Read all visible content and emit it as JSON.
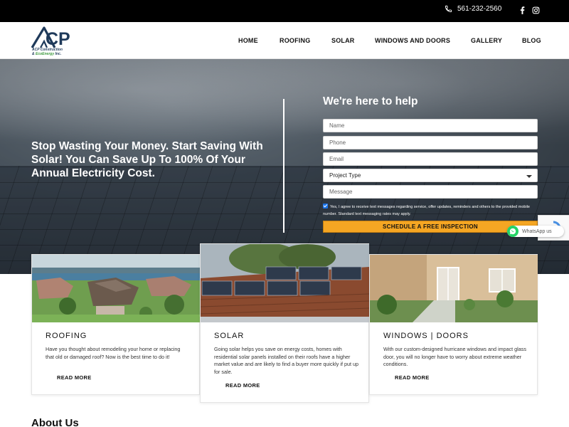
{
  "topbar": {
    "phone": "561-232-2560",
    "social": [
      "facebook-icon",
      "instagram-icon"
    ]
  },
  "brand": {
    "logo_letters": "CP",
    "logo_line1": "ACP Construction",
    "logo_line2_prefix": "& ",
    "logo_line2_eco": "EcoEnergy",
    "logo_line2_suffix": " Inc."
  },
  "nav": {
    "items": [
      "HOME",
      "ROOFING",
      "SOLAR",
      "WINDOWS AND DOORS",
      "GALLERY",
      "BLOG"
    ]
  },
  "hero": {
    "headline": "Stop Wasting Your Money. Start Saving With Solar! You Can Save Up To 100% Of Your Annual Electricity Cost."
  },
  "form": {
    "title": "We're here to help",
    "name_placeholder": "Name",
    "phone_placeholder": "Phone",
    "email_placeholder": "Email",
    "project_type": "Project Type",
    "message_placeholder": "Message",
    "consent_text": "Yes, I agree to receive text messages regarding service, offer updates, reminders and others to the provided mobile number. Standard text messaging rates may apply.",
    "consent_checked": true,
    "submit_label": "SCHEDULE A FREE INSPECTION"
  },
  "widgets": {
    "whatsapp_label": "WhatsApp us"
  },
  "services": [
    {
      "title": "ROOFING",
      "description": "Have you thought about remodeling your home or replacing that old or damaged roof? Now is the best time to do it!",
      "link": "READ MORE"
    },
    {
      "title": "SOLAR",
      "description": "Going solar helps you save on energy costs, homes with residential solar panels installed on their roofs have a higher market value and are likely to find a buyer more quickly if put up for sale.",
      "link": "READ MORE"
    },
    {
      "title": "WINDOWS | DOORS",
      "description": "With our custom-designed hurricane windows and impact glass door, you will no longer have to worry about extreme weather conditions.",
      "link": "READ MORE"
    }
  ],
  "about": {
    "heading": "About Us"
  },
  "colors": {
    "cta": "#f5a623",
    "topbar": "#000000",
    "whatsapp": "#25d366",
    "checkbox": "#1a73e8"
  }
}
